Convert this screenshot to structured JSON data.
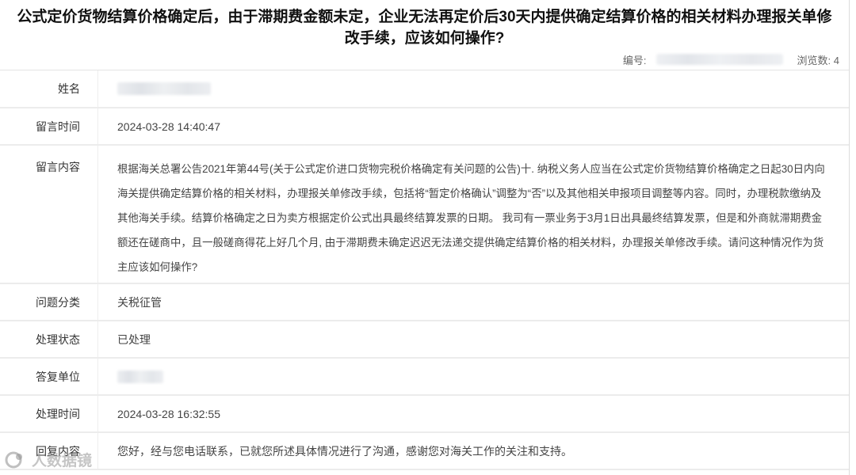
{
  "title": "公式定价货物结算价格确定后，由于滞期费金额未定，企业无法再定价后30天内提供确定结算价格的相关材料办理报关单修改手续，应该如何操作?",
  "meta": {
    "number_label": "编号:",
    "views_label": "浏览数: 4"
  },
  "rows": {
    "name": {
      "label": "姓名"
    },
    "time": {
      "label": "留言时间",
      "value": "2024-03-28 14:40:47"
    },
    "content": {
      "label": "留言内容",
      "value": "根据海关总署公告2021年第44号(关于公式定价进口货物完税价格确定有关问题的公告)十. 纳税义务人应当在公式定价货物结算价格确定之日起30日内向海关提供确定结算价格的相关材料，办理报关单修改手续，包括将“暂定价格确认”调整为“否”以及其他相关申报项目调整等内容。同时，办理税款缴纳及其他海关手续。结算价格确定之日为卖方根据定价公式出具最终结算发票的日期。 我司有一票业务于3月1日出具最终结算发票，但是和外商就滞期费金额还在磋商中，且一般磋商得花上好几个月, 由于滞期费未确定迟迟无法递交提供确定结算价格的相关材料，办理报关单修改手续。请问这种情况作为货主应该如何操作?"
    },
    "category": {
      "label": "问题分类",
      "value": "关税征管"
    },
    "status": {
      "label": "处理状态",
      "value": "已处理"
    },
    "unit": {
      "label": "答复单位"
    },
    "handled": {
      "label": "处理时间",
      "value": "2024-03-28 16:32:55"
    },
    "reply": {
      "label": "回复内容",
      "value": "您好，经与您电话联系，已就您所述具体情况进行了沟通，感谢您对海关工作的关注和支持。"
    }
  },
  "watermark": {
    "text": "人数据镜",
    "icon": "circle-logo-icon"
  }
}
